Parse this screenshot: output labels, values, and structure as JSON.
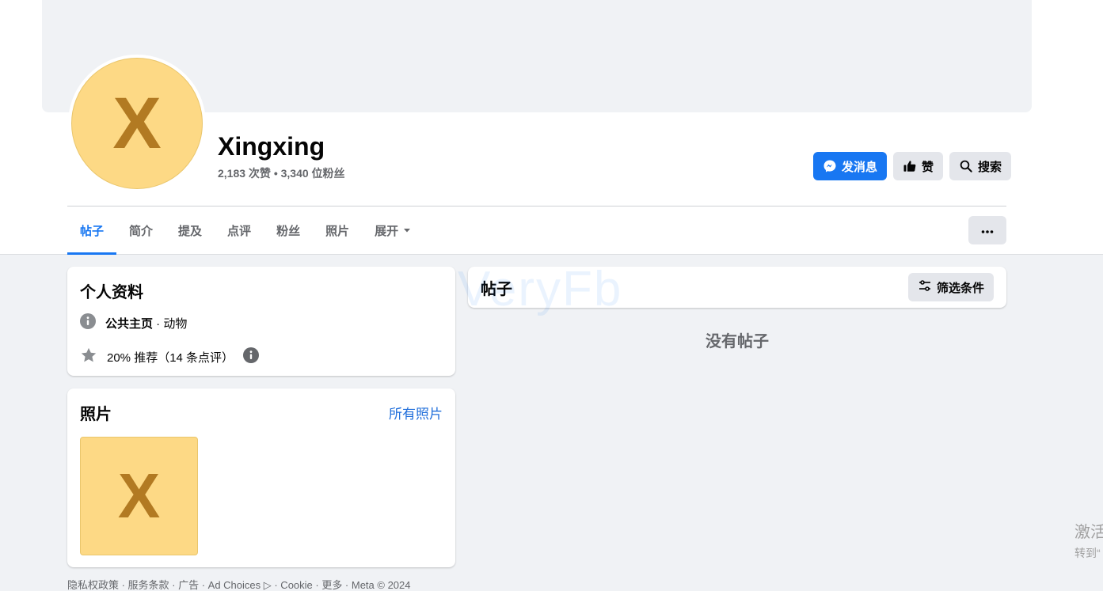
{
  "profile": {
    "avatar_letter": "X",
    "name": "Xingxing",
    "stats": "2,183 次赞 • 3,340 位粉丝"
  },
  "actions": {
    "message": "发消息",
    "like": "赞",
    "search": "搜索"
  },
  "tabs": [
    {
      "label": "帖子",
      "active": true
    },
    {
      "label": "简介"
    },
    {
      "label": "提及"
    },
    {
      "label": "点评"
    },
    {
      "label": "粉丝"
    },
    {
      "label": "照片"
    },
    {
      "label": "展开"
    }
  ],
  "intro": {
    "title": "个人资料",
    "page_type_bold": "公共主页",
    "page_type_rest": " · 动物",
    "rating": "20% 推荐（14 条点评）"
  },
  "photos": {
    "title": "照片",
    "all_link": "所有照片",
    "thumb_letter": "X"
  },
  "posts": {
    "title": "帖子",
    "filter": "筛选条件",
    "empty": "没有帖子",
    "watermark": "VeryFb"
  },
  "footer": {
    "text": "隐私权政策 · 服务条款 · 广告 · Ad Choices ▷ · Cookie · 更多 · Meta © 2024"
  },
  "activation": {
    "line1": "激活",
    "line2": "转到“"
  },
  "colors": {
    "accent": "#1877f2",
    "avatar_bg": "#fdd985",
    "avatar_letter": "#b27a22"
  }
}
